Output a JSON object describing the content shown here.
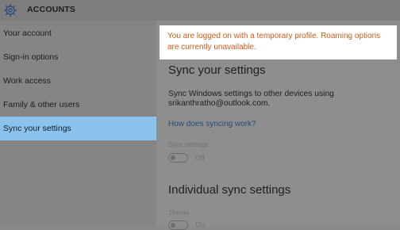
{
  "header": {
    "title": "ACCOUNTS",
    "icon": "gear-icon"
  },
  "sidebar": {
    "items": [
      {
        "label": "Your account"
      },
      {
        "label": "Sign-in options"
      },
      {
        "label": "Work access"
      },
      {
        "label": "Family & other users"
      },
      {
        "label": "Sync your settings",
        "selected": true
      }
    ]
  },
  "banner": {
    "message": "You are logged on with a temporary profile. Roaming options are currently unavailable.",
    "color": "#d05a1a"
  },
  "main": {
    "section_title": "Sync your settings",
    "description_line1": "Sync Windows settings to other devices using",
    "description_line2": "srikanthratho@outlook.com.",
    "link": "How does syncing work?",
    "sync_settings_label": "Sync settings",
    "sync_settings_state": "Off",
    "individual_title": "Individual sync settings",
    "theme_label": "Theme",
    "theme_state": "On"
  },
  "colors": {
    "accent_selected": "#8cc3ec"
  }
}
